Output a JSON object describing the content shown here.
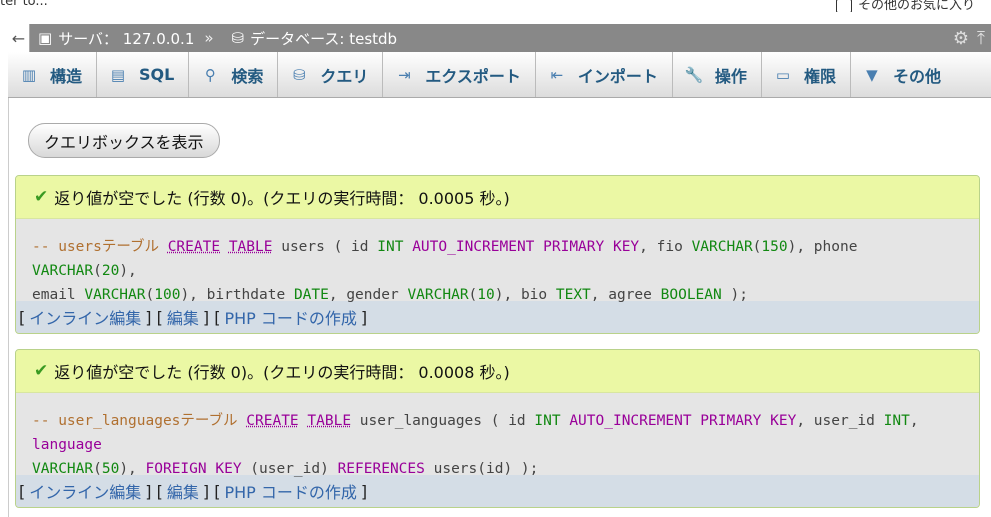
{
  "browser": {
    "left_text": "ter to...",
    "fav_label": "その他のお気に入り"
  },
  "serverbar": {
    "back_arrow": "←",
    "server_label": "サーバ： 127.0.0.1",
    "separator": "»",
    "database_label": "データベース: testdb"
  },
  "tabs": [
    {
      "label": "構造",
      "icon": "structure-icon"
    },
    {
      "label": "SQL",
      "icon": "sql-icon"
    },
    {
      "label": "検索",
      "icon": "search-icon"
    },
    {
      "label": "クエリ",
      "icon": "query-icon"
    },
    {
      "label": "エクスポート",
      "icon": "export-icon"
    },
    {
      "label": "インポート",
      "icon": "import-icon"
    },
    {
      "label": "操作",
      "icon": "wrench-icon"
    },
    {
      "label": "権限",
      "icon": "privileges-icon"
    },
    {
      "label": "その他",
      "icon": "dropdown-icon"
    }
  ],
  "show_query_button": "クエリボックスを表示",
  "results": [
    {
      "message": "返り値が空でした (行数 0)。(クエリの実行時間： 0.0005 秒。)",
      "sql_line1": {
        "comment": "-- usersテーブル",
        "kw1": "CREATE",
        "kw2": "TABLE",
        "rest1": " users ( id ",
        "t1": "INT",
        "s1": " ",
        "kw3": "AUTO_INCREMENT PRIMARY KEY",
        "s2": ", fio ",
        "t2": "VARCHAR",
        "s3": "(",
        "n1": "150",
        "s4": "), phone ",
        "t3": "VARCHAR",
        "s5": "(",
        "n2": "20",
        "s6": "),"
      },
      "sql_line2": {
        "s1": "email ",
        "t1": "VARCHAR",
        "s2": "(",
        "n1": "100",
        "s3": "), birthdate ",
        "t2": "DATE",
        "s4": ", gender ",
        "t3": "VARCHAR",
        "s5": "(",
        "n2": "10",
        "s6": "), bio ",
        "t4": "TEXT",
        "s7": ", agree ",
        "t5": "BOOLEAN",
        "s8": " );"
      },
      "links": {
        "inline_edit": "インライン編集",
        "edit": "編集",
        "php": "PHP コードの作成"
      }
    },
    {
      "message": "返り値が空でした (行数 0)。(クエリの実行時間： 0.0008 秒。)",
      "sql_line1": {
        "comment": "-- user_languagesテーブル",
        "kw1": "CREATE",
        "kw2": "TABLE",
        "rest1": " user_languages ( id ",
        "t1": "INT",
        "s1": " ",
        "kw3": "AUTO_INCREMENT PRIMARY KEY",
        "s2": ", user_id ",
        "t2": "INT",
        "s3": ", ",
        "kw4": "language"
      },
      "sql_line2": {
        "t1": "VARCHAR",
        "s1": "(",
        "n1": "50",
        "s2": "), ",
        "kw1": "FOREIGN KEY",
        "s3": " (user_id) ",
        "kw2": "REFERENCES",
        "s4": " users(id) );"
      },
      "links": {
        "inline_edit": "インライン編集",
        "edit": "編集",
        "php": "PHP コードの作成"
      }
    }
  ],
  "colors": {
    "success_bg": "#ebf8a4",
    "link": "#3366aa",
    "keyword": "#990099",
    "type": "#118811",
    "comment": "#b07030"
  }
}
